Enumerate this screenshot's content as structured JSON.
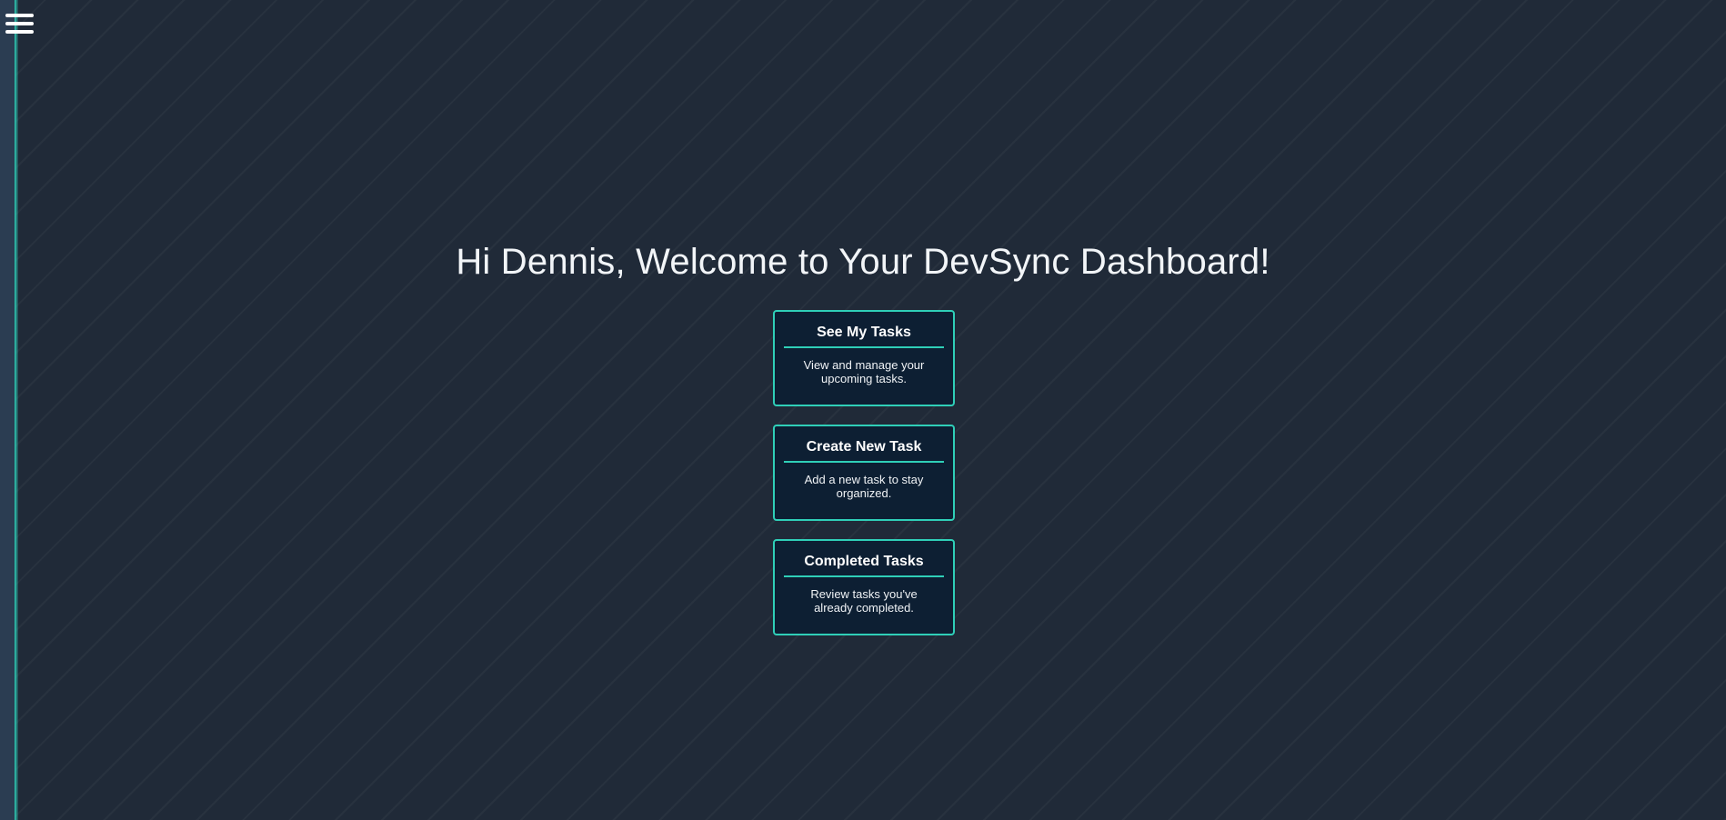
{
  "nav": {
    "menu_icon": "hamburger-menu-icon"
  },
  "header": {
    "welcome": "Hi Dennis, Welcome to Your DevSync Dashboard!"
  },
  "cards": [
    {
      "title": "See My Tasks",
      "description": "View and manage your upcoming tasks."
    },
    {
      "title": "Create New Task",
      "description": "Add a new task to stay organized."
    },
    {
      "title": "Completed Tasks",
      "description": "Review tasks you've already completed."
    }
  ],
  "colors": {
    "background": "#202a38",
    "accent": "#2fcfb8",
    "card_background": "#0d1f33",
    "sidebar": "#2b3d52"
  }
}
